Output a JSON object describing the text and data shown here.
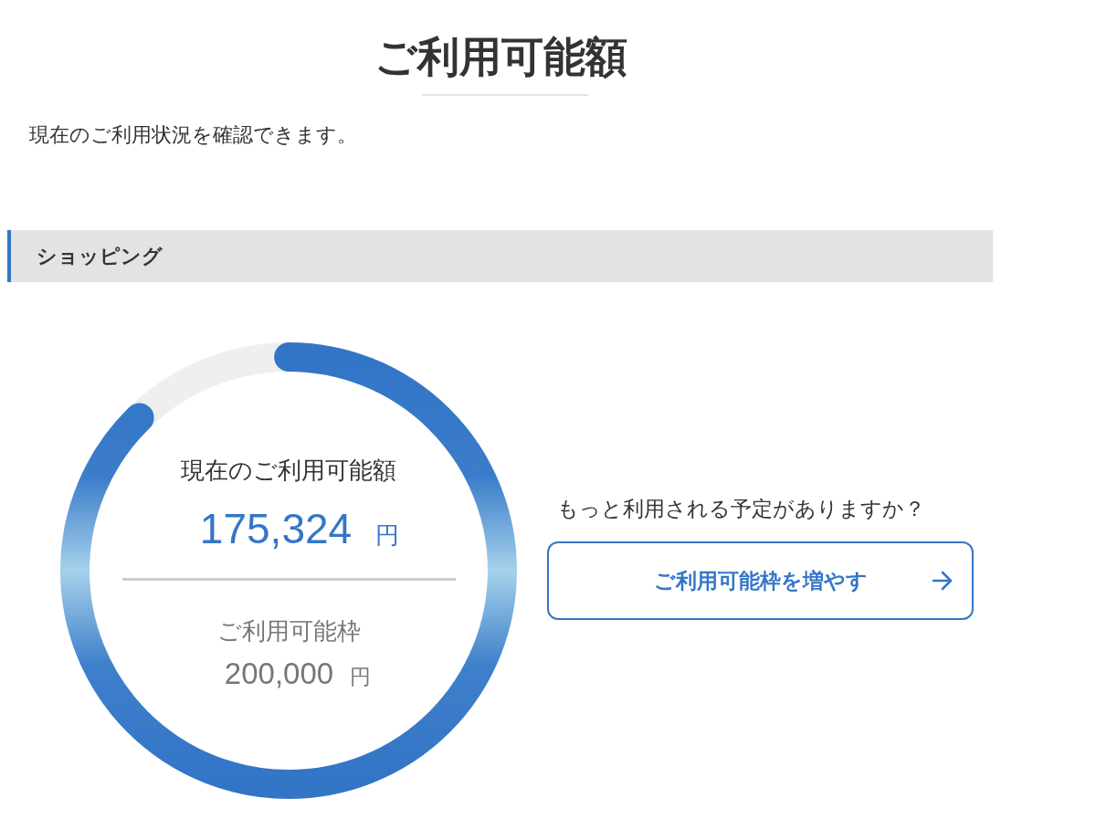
{
  "page": {
    "title": "ご利用可能額",
    "description": "現在のご利用状況を確認できます。"
  },
  "section": {
    "heading": "ショッピング",
    "gauge": {
      "level": 0.877,
      "label": "現在のご利用可能額",
      "amount": "175,324",
      "amount_unit": "円",
      "limit_label": "ご利用可能枠",
      "limit": "200,000",
      "limit_unit": "円"
    },
    "prompt": "もっと利用される予定がありますか？",
    "button": {
      "label": "ご利用可能枠を増やす"
    }
  }
}
